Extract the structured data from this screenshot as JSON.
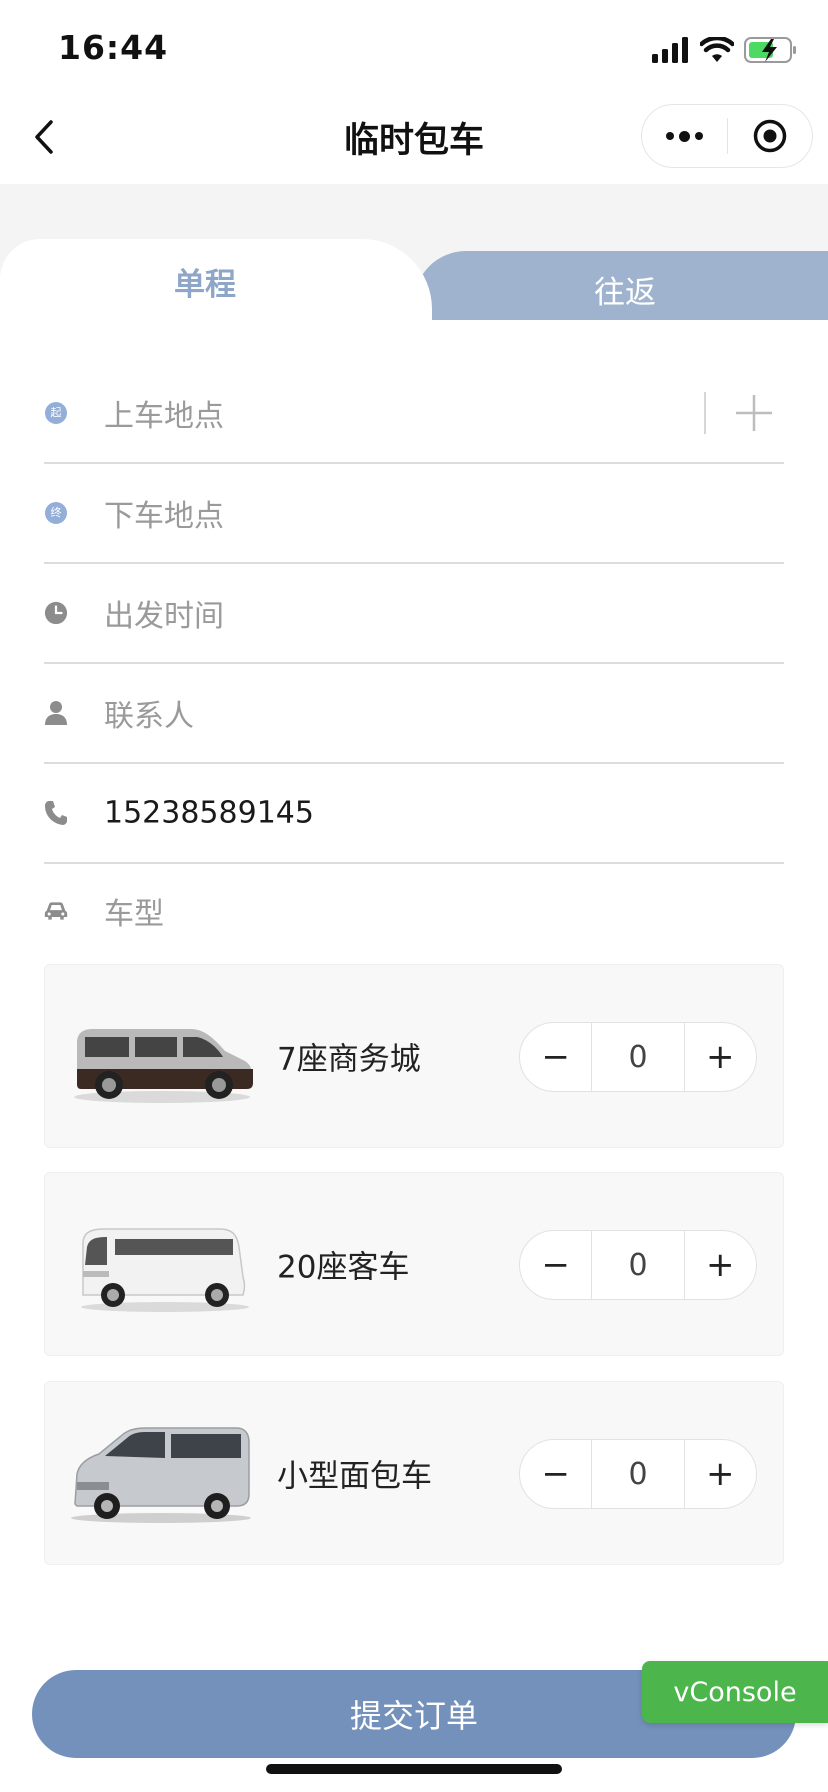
{
  "status_bar": {
    "time": "16:44"
  },
  "nav": {
    "title": "临时包车"
  },
  "tabs": [
    {
      "label": "单程",
      "active": true
    },
    {
      "label": "往返",
      "active": false
    }
  ],
  "form": {
    "pickup": {
      "badge": "起",
      "placeholder": "上车地点"
    },
    "dropoff": {
      "badge": "终",
      "placeholder": "下车地点"
    },
    "departure_time": {
      "placeholder": "出发时间"
    },
    "contact": {
      "placeholder": "联系人"
    },
    "phone": {
      "value": "15238589145"
    },
    "vehicle_type": {
      "label": "车型"
    }
  },
  "vehicles": [
    {
      "name": "7座商务城",
      "count": "0",
      "color": "#6b5a4e"
    },
    {
      "name": "20座客车",
      "count": "0",
      "color": "#ffffff"
    },
    {
      "name": "小型面包车",
      "count": "0",
      "color": "#c9ccd0"
    }
  ],
  "stepper": {
    "minus": "−",
    "plus": "+"
  },
  "submit": {
    "label": "提交订单"
  },
  "vconsole": {
    "label": "vConsole"
  },
  "colors": {
    "accent": "#7391bb",
    "tab_inactive": "#9fb3cf",
    "tab_active_text": "#8ea6c8",
    "vconsole": "#4cb64c"
  }
}
